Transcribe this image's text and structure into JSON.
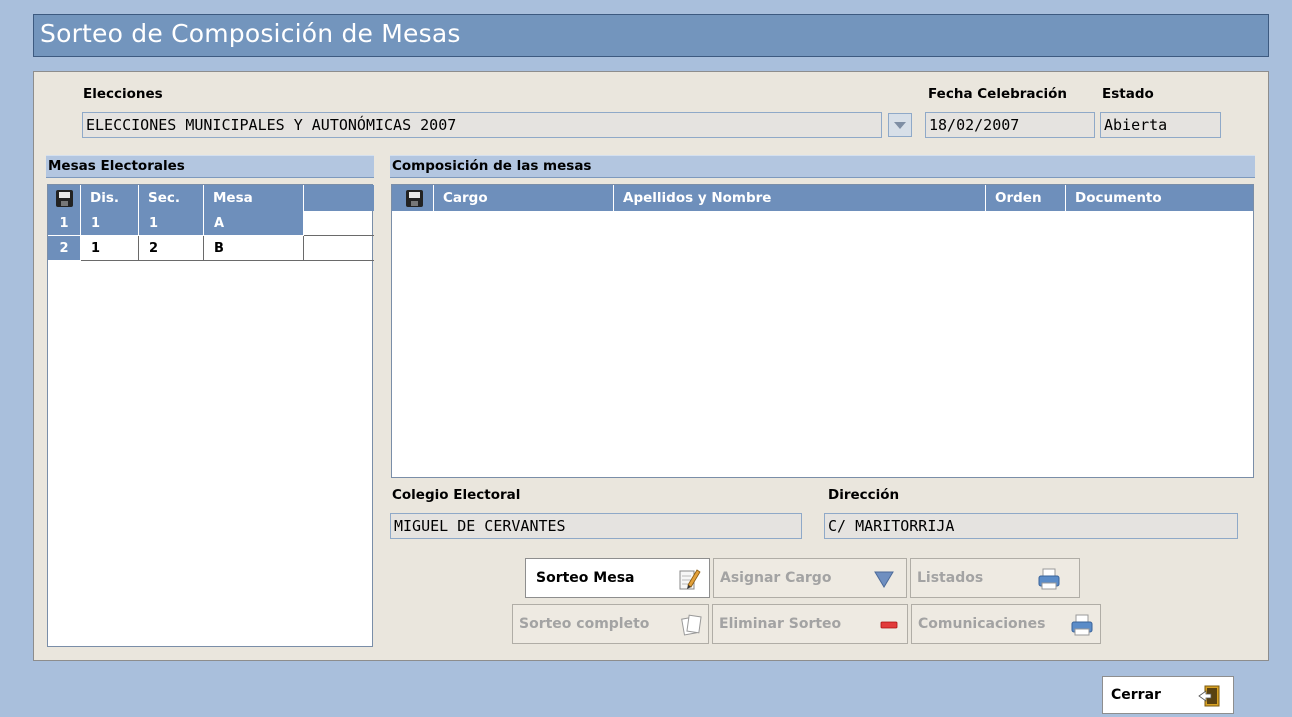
{
  "window": {
    "title": "Sorteo de Composición de Mesas"
  },
  "header": {
    "elecciones_label": "Elecciones",
    "elecciones_value": "ELECCIONES MUNICIPALES Y AUTONÓMICAS 2007",
    "fecha_label": "Fecha Celebración",
    "fecha_value": "18/02/2007",
    "estado_label": "Estado",
    "estado_value": "Abierta"
  },
  "mesas": {
    "title": "Mesas Electorales",
    "columns": [
      "Dis.",
      "Sec.",
      "Mesa"
    ],
    "rows": [
      {
        "num": "1",
        "dis": "1",
        "sec": "1",
        "mesa": "A"
      },
      {
        "num": "2",
        "dis": "1",
        "sec": "2",
        "mesa": "B"
      }
    ]
  },
  "composicion": {
    "title": "Composición de las mesas",
    "columns": [
      "Cargo",
      "Apellidos y Nombre",
      "Orden",
      "Documento"
    ]
  },
  "colegio": {
    "colegio_label": "Colegio Electoral",
    "colegio_value": "MIGUEL DE CERVANTES",
    "direccion_label": "Dirección",
    "direccion_value": "C/ MARITORRIJA"
  },
  "buttons": {
    "sorteo_mesa": "Sorteo Mesa",
    "asignar_cargo": "Asignar Cargo",
    "listados": "Listados",
    "sorteo_completo": "Sorteo completo",
    "eliminar_sorteo": "Eliminar Sorteo",
    "comunicaciones": "Comunicaciones",
    "cerrar": "Cerrar"
  },
  "icons": {
    "save": "floppy-disk-icon",
    "dropdown": "chevron-down-icon",
    "pencil": "pencil-notepad-icon",
    "triangle": "down-triangle-icon",
    "printer": "printer-icon",
    "pages": "pages-icon",
    "remove": "red-minus-icon",
    "exit": "exit-door-icon"
  },
  "colors": {
    "background": "#a9bfdc",
    "title_bar": "#7395bd",
    "grid_header": "#6e8fbb",
    "panel": "#eae6dd"
  }
}
